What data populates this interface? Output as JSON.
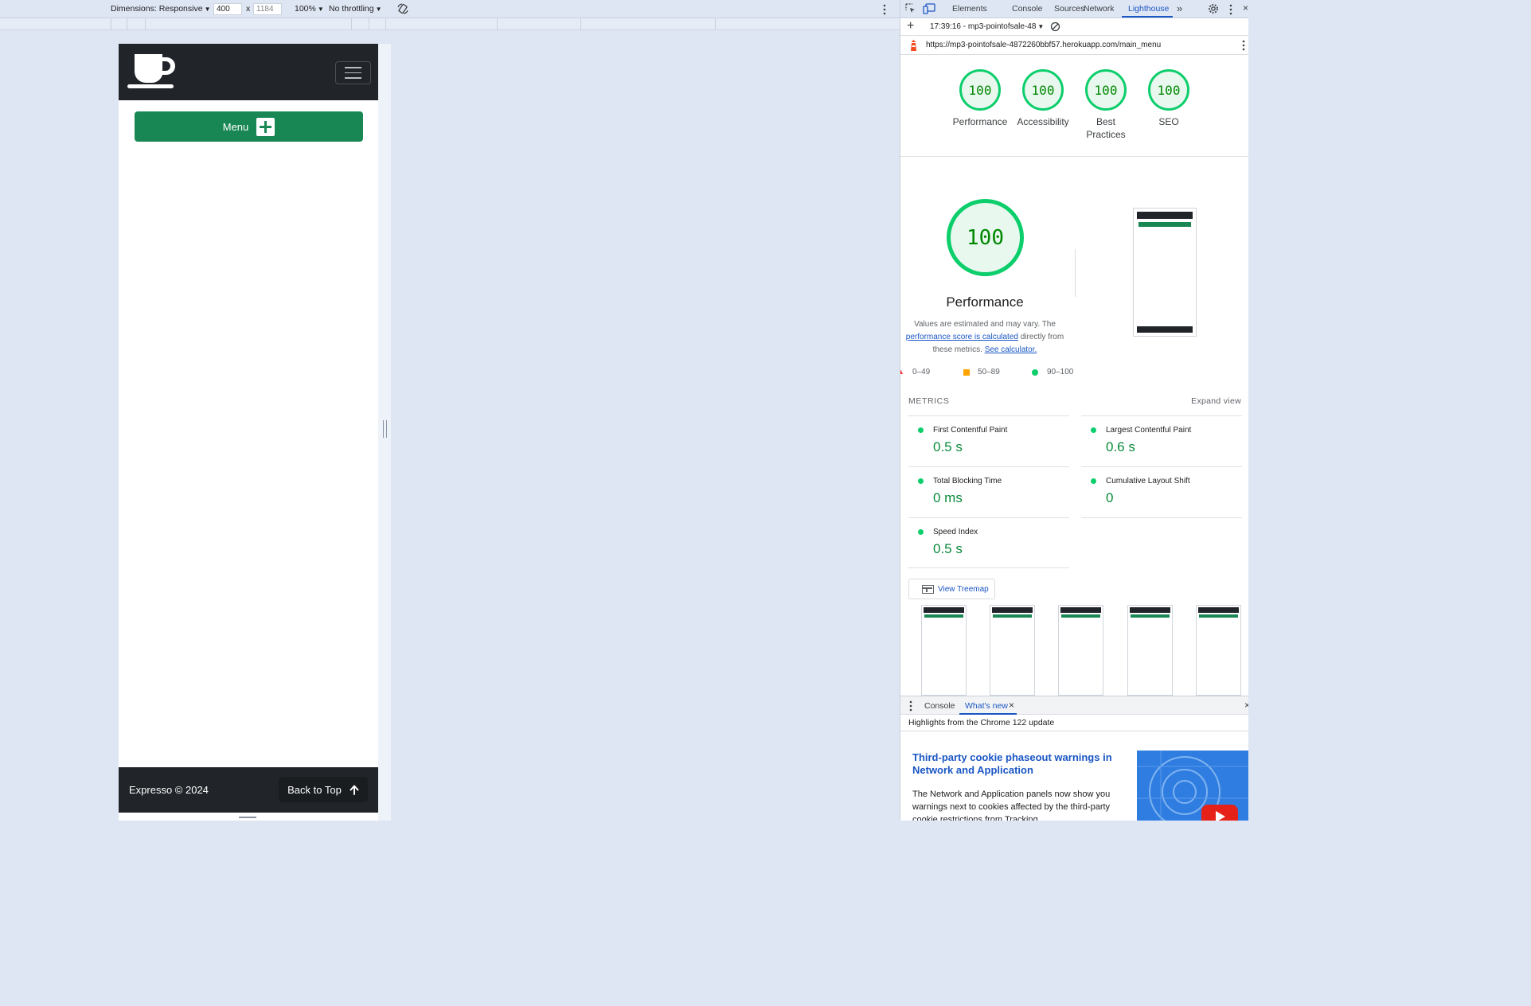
{
  "device_toolbar": {
    "dimensions_label": "Dimensions: Responsive",
    "width_value": "400",
    "times": "x",
    "height_value": "1184",
    "zoom": "100%",
    "throttling": "No throttling"
  },
  "site": {
    "menu_label": "Menu",
    "footer_copyright": "Expresso © 2024",
    "back_to_top_label": "Back to Top"
  },
  "devtools": {
    "tabs": [
      "Elements",
      "Console",
      "Sources",
      "Network",
      "Lighthouse"
    ],
    "active_tab": "Lighthouse",
    "report_selector": "17:39:16 - mp3-pointofsale-48",
    "url": "https://mp3-pointofsale-4872260bbf57.herokuapp.com/main_menu",
    "scores": [
      {
        "value": "100",
        "label": "Performance"
      },
      {
        "value": "100",
        "label": "Accessibility"
      },
      {
        "value": "100",
        "label": "Best Practices"
      },
      {
        "value": "100",
        "label": "SEO"
      }
    ],
    "performance": {
      "score": "100",
      "title": "Performance",
      "desc_1": "Values are estimated and may vary. The",
      "desc_link": "performance score is calculated",
      "desc_2": "directly from these metrics.",
      "calc_link": "See calculator."
    },
    "legend": [
      "0–49",
      "50–89",
      "90–100"
    ],
    "metrics_title": "METRICS",
    "expand_view": "Expand view",
    "metrics": [
      {
        "name": "First Contentful Paint",
        "value": "0.5 s"
      },
      {
        "name": "Largest Contentful Paint",
        "value": "0.6 s"
      },
      {
        "name": "Total Blocking Time",
        "value": "0 ms"
      },
      {
        "name": "Cumulative Layout Shift",
        "value": "0"
      },
      {
        "name": "Speed Index",
        "value": "0.5 s"
      }
    ],
    "treemap_label": "View Treemap",
    "drawer": {
      "tabs": [
        "Console",
        "What's new"
      ],
      "highlights": "Highlights from the Chrome 122 update",
      "article_title": "Third-party cookie phaseout warnings in Network and Application",
      "article_body": "The Network and Application panels now show you warnings next to cookies affected by the third-party cookie restrictions from Tracking"
    }
  },
  "colors": {
    "pass_green": "#0cce6b",
    "bootstrap_success": "#198754",
    "navbar_dark": "#212529",
    "link_blue": "#1a56c4"
  }
}
